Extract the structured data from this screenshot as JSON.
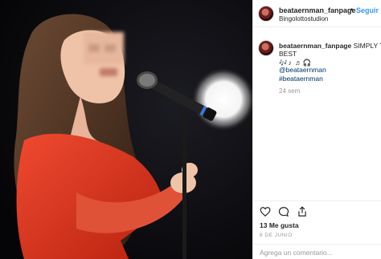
{
  "header": {
    "username": "beataernman_fanpage",
    "separator": "•",
    "follow_label": "Seguir",
    "location": "Bingolottostudion"
  },
  "caption": {
    "username": "beataernman_fanpage",
    "text_line1": "SIMPLY THE",
    "text_line2": "BEST",
    "emoji_line": "🎶♪ ♬🎧",
    "hashtags": [
      "@beataernman",
      "#beataernman"
    ],
    "time_ago": "24 sem"
  },
  "actions": {
    "icons": [
      "heart-icon",
      "comment-icon",
      "share-icon"
    ]
  },
  "likes": "13 Me gusta",
  "date": "8 DE JUNIO",
  "comment_input": {
    "placeholder": "Agrega un comentario...",
    "value": ""
  },
  "colors": {
    "link": "#3897f0",
    "hashtag": "#003569",
    "muted": "#999999",
    "dress": "#d8311f",
    "background_photo": "#0b0b0d"
  }
}
